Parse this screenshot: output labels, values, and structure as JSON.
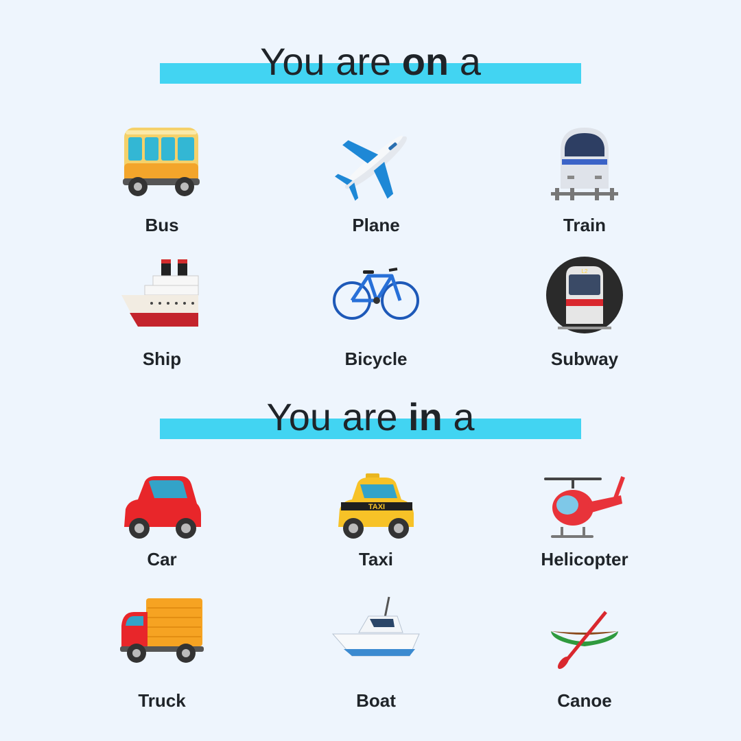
{
  "sections": [
    {
      "title_pre": "You are ",
      "title_bold": "on",
      "title_post": " a",
      "items": [
        {
          "label": "Bus",
          "icon": "bus-icon"
        },
        {
          "label": "Plane",
          "icon": "airplane-icon"
        },
        {
          "label": "Train",
          "icon": "train-icon"
        },
        {
          "label": "Ship",
          "icon": "ship-icon"
        },
        {
          "label": "Bicycle",
          "icon": "bicycle-icon"
        },
        {
          "label": "Subway",
          "icon": "subway-icon"
        }
      ]
    },
    {
      "title_pre": "You are ",
      "title_bold": "in",
      "title_post": " a",
      "items": [
        {
          "label": "Car",
          "icon": "car-icon"
        },
        {
          "label": "Taxi",
          "icon": "taxi-icon"
        },
        {
          "label": "Helicopter",
          "icon": "helicopter-icon"
        },
        {
          "label": "Truck",
          "icon": "truck-icon"
        },
        {
          "label": "Boat",
          "icon": "boat-icon"
        },
        {
          "label": "Canoe",
          "icon": "canoe-icon"
        }
      ]
    }
  ],
  "taxi_sign": "TAXI",
  "subway_sign": "L2",
  "colors": {
    "background": "#eef5fd",
    "highlight_bar": "#42d4f2",
    "text": "#1f2429"
  }
}
